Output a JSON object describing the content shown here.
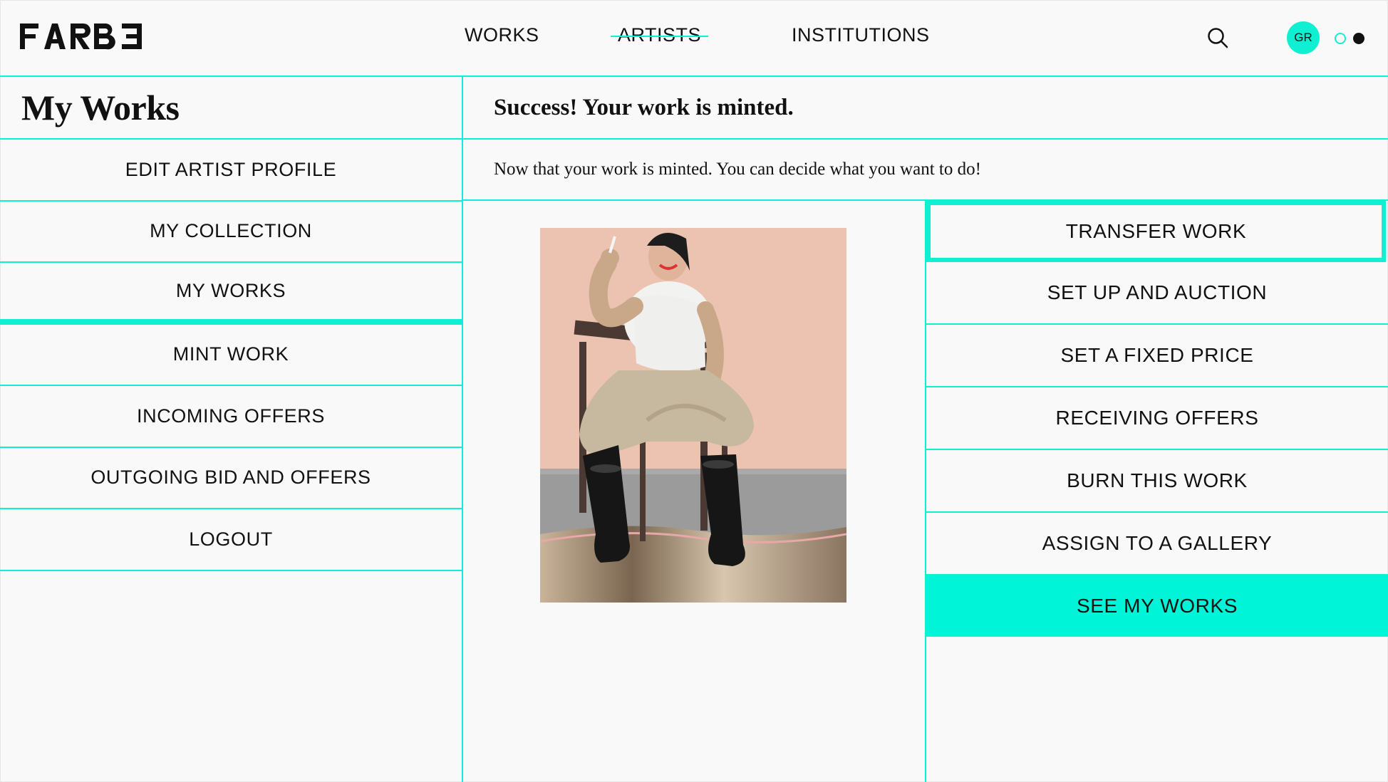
{
  "brand": {
    "logo_text": "FARBƎ"
  },
  "nav": {
    "links": [
      "WORKS",
      "ARTISTS",
      "INSTITUTIONS"
    ],
    "avatar_initials": "GR"
  },
  "sidebar": {
    "title": "My Works",
    "items": [
      {
        "label": "EDIT ARTIST PROFILE"
      },
      {
        "label": "MY COLLECTION"
      },
      {
        "label": "MY WORKS",
        "active": true
      },
      {
        "label": "MINT WORK"
      },
      {
        "label": "INCOMING OFFERS"
      },
      {
        "label": "OUTGOING BID AND OFFERS"
      },
      {
        "label": "LOGOUT"
      }
    ]
  },
  "main": {
    "title": "Success! Your work is minted.",
    "description": "Now that your work is minted. You can decide what you want to do!",
    "actions": [
      {
        "label": "TRANSFER WORK"
      },
      {
        "label": "SET UP AND AUCTION"
      },
      {
        "label": "SET A FIXED PRICE"
      },
      {
        "label": "RECEIVING OFFERS"
      },
      {
        "label": "BURN THIS WORK"
      },
      {
        "label": "ASSIGN TO A GALLERY"
      },
      {
        "label": "SEE MY WORKS"
      }
    ]
  },
  "colors": {
    "accent": "#0ff0d2",
    "primary_button": "#00f5d8",
    "text": "#111111"
  }
}
